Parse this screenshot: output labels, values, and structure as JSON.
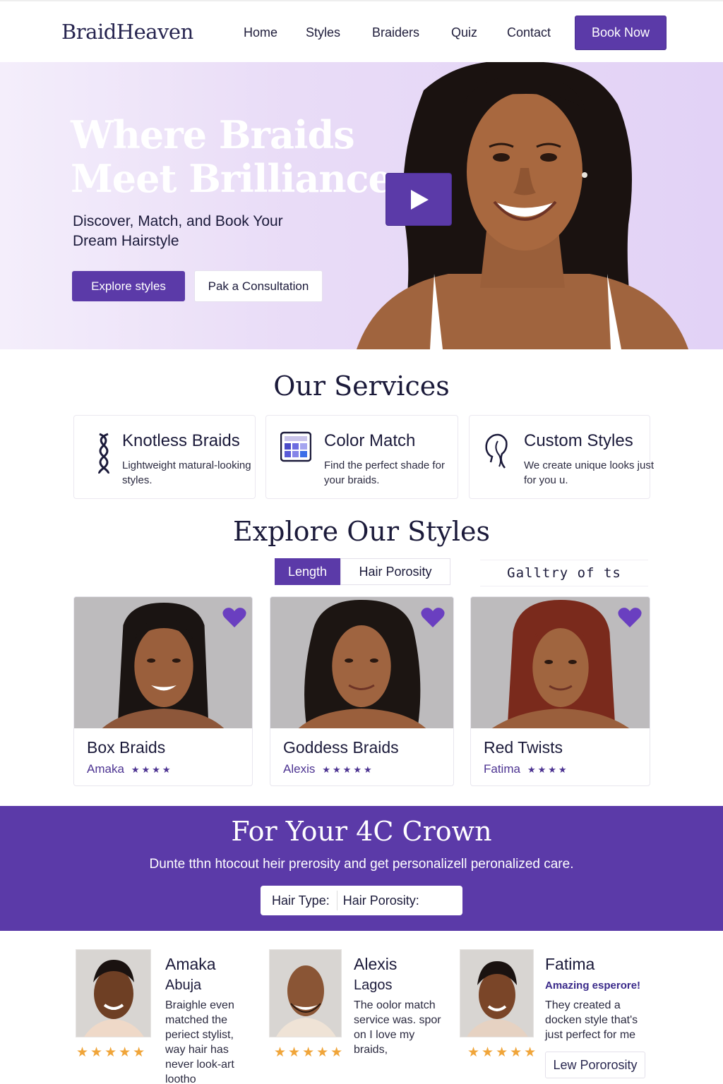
{
  "brand": "BraidHeaven",
  "nav": {
    "links": [
      "Home",
      "Styles",
      "Braiders",
      "Quiz",
      "Contact"
    ],
    "cta": "Book Now"
  },
  "hero": {
    "title_line1": "Where Braids",
    "title_line2": "Meet Brilliance",
    "subtitle": "Discover, Match, and Book Your Dream Hairstyle",
    "primary_button": "Explore styles",
    "secondary_button": "Pak a Consultation"
  },
  "services": {
    "title": "Our Services",
    "items": [
      {
        "title": "Knotless Braids",
        "desc": "Lightweight matural-looking styles.",
        "icon": "braid-icon"
      },
      {
        "title": "Color Match",
        "desc": "Find the perfect shade for your braids.",
        "icon": "color-palette-icon"
      },
      {
        "title": "Custom Styles",
        "desc": "We create unique looks just for you u.",
        "icon": "head-profile-icon"
      }
    ]
  },
  "styles": {
    "title": "Explore Our Styles",
    "filters": [
      "Length",
      "Hair Porosity"
    ],
    "active_filter": "Length",
    "gallery_label": "Galltry of ts",
    "cards": [
      {
        "name": "Box Braids",
        "author": "Amaka",
        "stars": "★★★★",
        "hair_color": "#1a1412"
      },
      {
        "name": "Goddess Braids",
        "author": "Alexis",
        "stars": "★★★★★",
        "hair_color": "#1c1512"
      },
      {
        "name": "Red Twists",
        "author": "Fatima",
        "stars": "★★★★",
        "hair_color": "#7a2a1c"
      }
    ]
  },
  "banner": {
    "title": "For Your 4C Crown",
    "subtitle": "Dunte tthn htocout heir prerosity and get personalizell peronalized care.",
    "hair_type_label": "Hair Type:",
    "hair_porosity_label": "Hair Porosity:"
  },
  "reviews": [
    {
      "name": "Amaka",
      "city": "Abuja",
      "text": "Braighle even matched the periect stylist, way hair has never look-art lootho",
      "stars": "★★★★★"
    },
    {
      "name": "Alexis",
      "city": "Lagos",
      "text": "The oolor match service was. spor on I love my braids,",
      "stars": "★★★★★"
    },
    {
      "name": "Fatima",
      "tag": "Amazing esperore!",
      "text": "They created a docken style that's just perfect for me",
      "stars": "★★★★★",
      "chip": "Lew Pororosity"
    }
  ],
  "colors": {
    "accent": "#5b3aa8",
    "star": "#f0a53a",
    "hero_bg": "#e6d8f6"
  }
}
